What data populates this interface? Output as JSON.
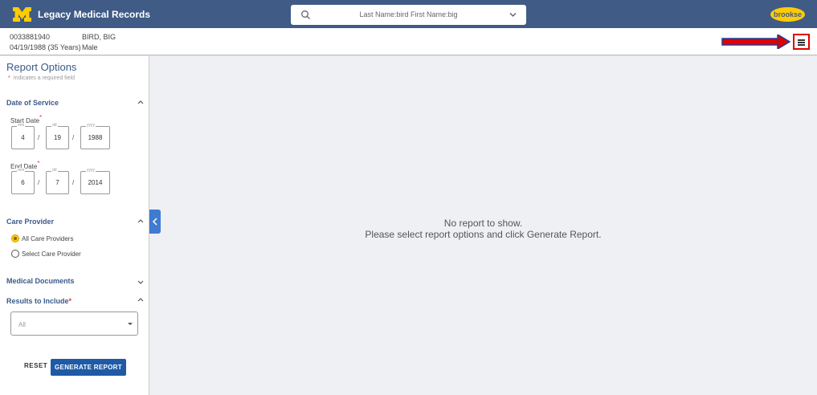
{
  "app": {
    "title": "Legacy Medical Records",
    "logo": "M"
  },
  "search": {
    "text": "Last Name:bird First Name:big"
  },
  "user": {
    "name": "brookse"
  },
  "patient": {
    "mrn": "0033881940",
    "name": "BIRD, BIG",
    "dob": "04/19/1988 (35 Years)",
    "sex": "Male"
  },
  "report": {
    "title": "Report Options",
    "required_star": "*",
    "required_note": "Indicates a required field",
    "date_section": "Date of Service",
    "start_label": "Start Date",
    "end_label": "End Date",
    "placeholders": {
      "mm": "mm",
      "dd": "dd",
      "yyyy": "yyyy"
    },
    "slash": "/",
    "start": {
      "mm": "4",
      "dd": "19",
      "yyyy": "1988"
    },
    "end": {
      "mm": "6",
      "dd": "7",
      "yyyy": "2014"
    },
    "care_section": "Care Provider",
    "care_options": [
      "All Care Providers",
      "Select Care Provider"
    ],
    "care_selected": "All Care Providers",
    "docs_section": "Medical Documents",
    "results_section": "Results to Include",
    "results_value": "All",
    "reset": "RESET",
    "generate": "GENERATE REPORT"
  },
  "main": {
    "empty_line1": "No report to show.",
    "empty_line2": "Please select report options and click Generate Report."
  },
  "colors": {
    "header": "#3f5b86",
    "brand_yellow": "#ffcb05",
    "primary_button": "#1f5aa6",
    "required": "#e53935",
    "highlight": "#e00000"
  },
  "icons": [
    "maize-m-logo",
    "search-icon",
    "chevron-down-icon",
    "hamburger-menu-icon",
    "chevron-left-icon",
    "chevron-up-icon"
  ]
}
